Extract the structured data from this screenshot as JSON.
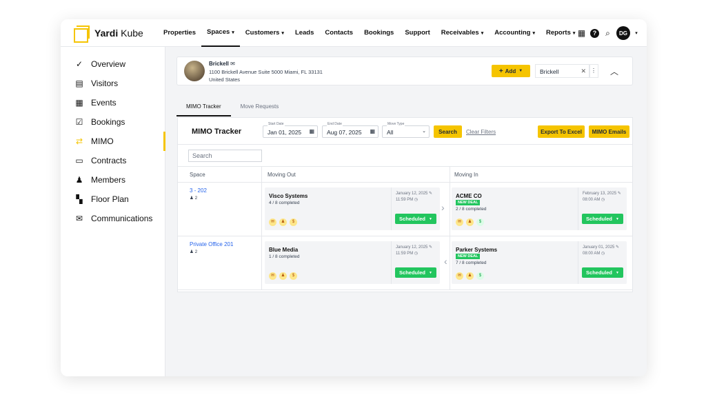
{
  "app": {
    "logo_bold": "Yardi",
    "logo_rest": "Kube"
  },
  "nav": [
    {
      "label": "Properties",
      "caret": false
    },
    {
      "label": "Spaces",
      "caret": true
    },
    {
      "label": "Customers",
      "caret": true
    },
    {
      "label": "Leads",
      "caret": false
    },
    {
      "label": "Contacts",
      "caret": false
    },
    {
      "label": "Bookings",
      "caret": false
    },
    {
      "label": "Support",
      "caret": false
    },
    {
      "label": "Receivables",
      "caret": true
    },
    {
      "label": "Accounting",
      "caret": true
    },
    {
      "label": "Reports",
      "caret": true
    }
  ],
  "user": {
    "initials": "DG"
  },
  "sidebar": {
    "items": [
      {
        "label": "Overview",
        "icon": "check-circle-icon",
        "glyph": "⊘"
      },
      {
        "label": "Visitors",
        "icon": "id-card-icon",
        "glyph": "▤"
      },
      {
        "label": "Events",
        "icon": "calendar-icon",
        "glyph": "▦"
      },
      {
        "label": "Bookings",
        "icon": "calendar-check-icon",
        "glyph": "☑"
      },
      {
        "label": "MIMO",
        "icon": "swap-arrows-icon",
        "glyph": "⇄"
      },
      {
        "label": "Contracts",
        "icon": "contract-icon",
        "glyph": "▭"
      },
      {
        "label": "Members",
        "icon": "members-icon",
        "glyph": "👥"
      },
      {
        "label": "Floor Plan",
        "icon": "floor-plan-icon",
        "glyph": "▚"
      },
      {
        "label": "Communications",
        "icon": "mail-settings-icon",
        "glyph": "✉"
      }
    ]
  },
  "property": {
    "name": "Brickell",
    "address_line1": "1100 Brickell Avenue Suite 5000 Miami, FL 33131",
    "address_line2": "United States",
    "add_label": "Add",
    "selected": "Brickell"
  },
  "tabs": [
    "MIMO Tracker",
    "Move Requests"
  ],
  "tracker": {
    "title": "MIMO Tracker",
    "start_label": "Start Date",
    "start_value": "Jan 01, 2025",
    "end_label": "End Date",
    "end_value": "Aug 07, 2025",
    "type_label": "Move Type",
    "type_value": "All",
    "search_btn": "Search",
    "clear_filters": "Clear Filters",
    "export_btn": "Export To Excel",
    "emails_btn": "MIMO Emails",
    "search_placeholder": "Search",
    "columns": [
      "Space",
      "Moving Out",
      "Moving In"
    ]
  },
  "rows": [
    {
      "space": "3 - 202",
      "capacity": "2",
      "out": {
        "company": "Visco Systems",
        "progress": "4 / 8 completed",
        "date": "January 12, 2025",
        "time": "11:59 PM",
        "status": "Scheduled"
      },
      "in": {
        "company": "ACME CO",
        "badge": "NEW DEAL",
        "progress": "2 / 8 completed",
        "date": "February 13, 2025",
        "time": "08:00 AM",
        "status": "Scheduled"
      }
    },
    {
      "space": "Private Office 201",
      "capacity": "2",
      "out": {
        "company": "Blue Media",
        "progress": "1 / 8 completed",
        "date": "January 12, 2025",
        "time": "11:59 PM",
        "status": "Scheduled"
      },
      "in": {
        "company": "Parker Systems",
        "badge": "NEW DEAL",
        "progress": "7 / 8 completed",
        "date": "January 01, 2025",
        "time": "08:00 AM",
        "status": "Scheduled"
      }
    }
  ],
  "colors": {
    "accent": "#f5c400",
    "success": "#22c55e",
    "link": "#2563eb"
  }
}
